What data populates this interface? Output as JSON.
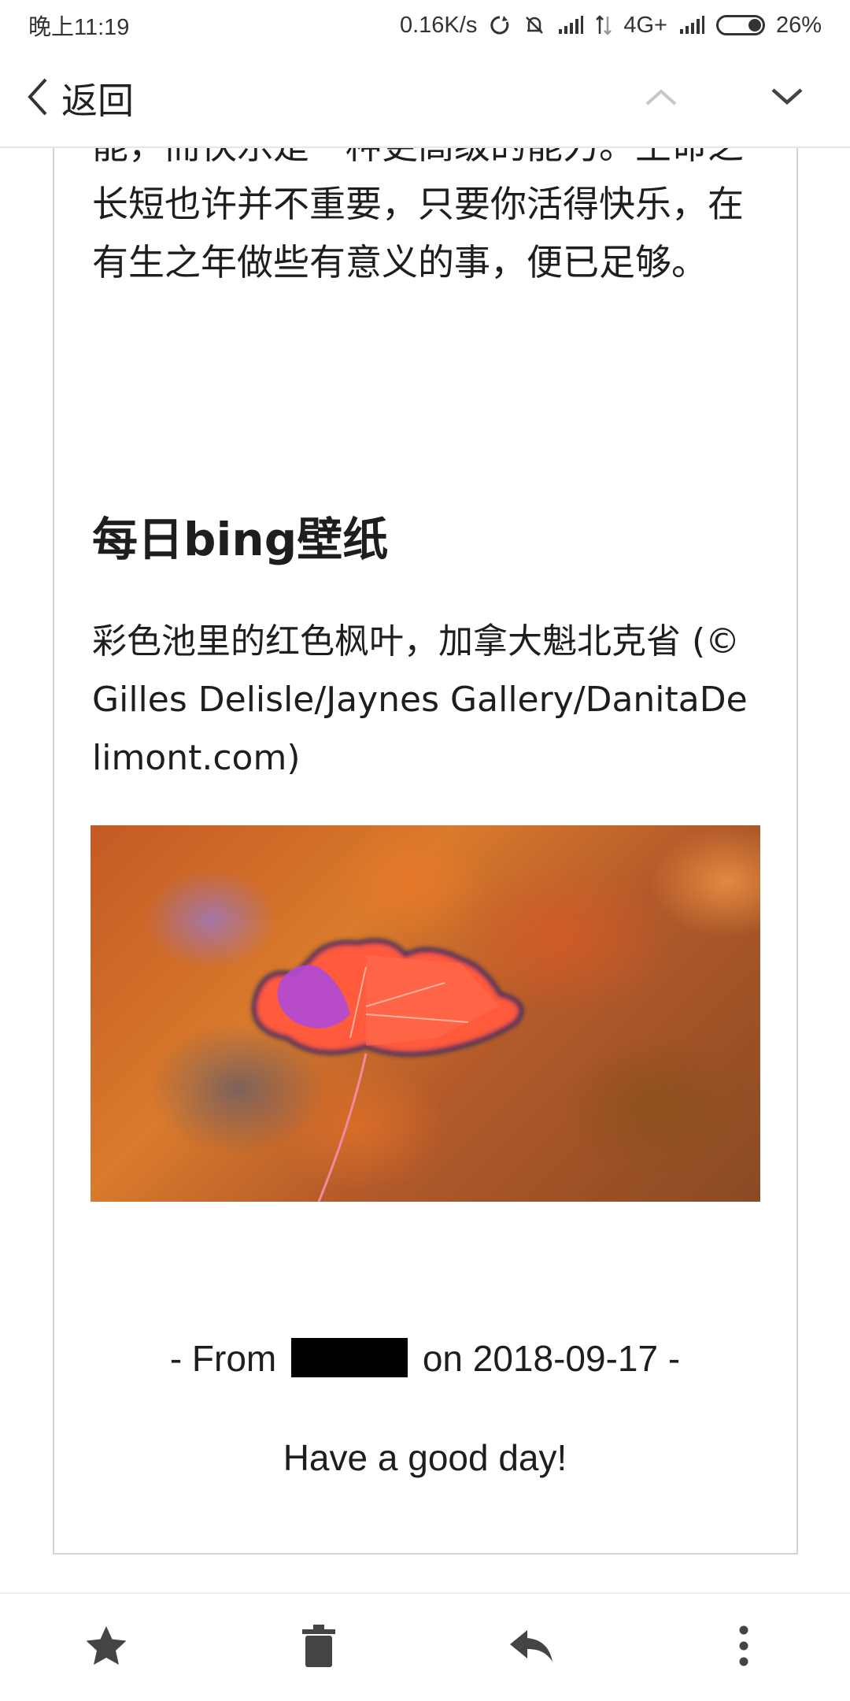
{
  "status_bar": {
    "time": "晚上11:19",
    "network_speed": "0.16K/s",
    "network_type": "4G+",
    "battery_percent": "26%",
    "icons": [
      "sync-icon",
      "mute-bell-icon",
      "signal-icon",
      "data-arrows-icon",
      "signal-icon",
      "battery-icon"
    ]
  },
  "app_bar": {
    "back_label": "返回",
    "prev_icon": "chevron-up-icon",
    "next_icon": "chevron-down-icon"
  },
  "email": {
    "intro_paragraph": "能，而快乐是一种更高级的能力。生命之长短也许并不重要，只要你活得快乐，在有生之年做些有意义的事，便已足够。",
    "section_title": "每日bing壁纸",
    "image_caption": "彩色池里的红色枫叶，加拿大魁北克省 (© Gilles Delisle/Jaynes Gallery/DanitaDelimont.com)",
    "from_prefix": "- From",
    "from_suffix": "on 2018-09-17 -",
    "closing": "Have a good day!"
  },
  "bottom_bar": {
    "actions": [
      {
        "name": "star-icon"
      },
      {
        "name": "trash-icon"
      },
      {
        "name": "reply-icon"
      },
      {
        "name": "more-vert-icon"
      }
    ]
  },
  "colors": {
    "text": "#1e1e1e",
    "icon": "#444444",
    "divider": "#d3d3d3",
    "disabled_arrow": "#c8c8c8"
  }
}
